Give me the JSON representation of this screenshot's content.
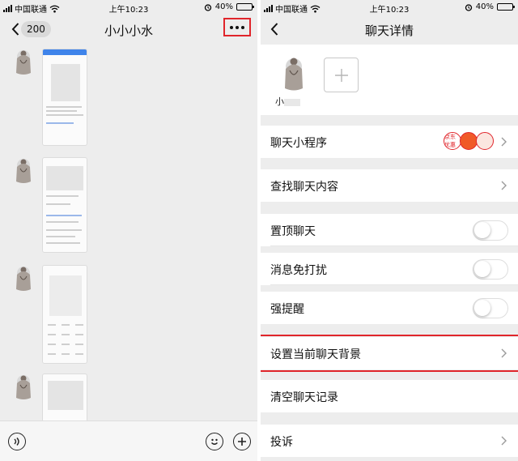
{
  "status_bar": {
    "carrier": "中国联通",
    "time": "上午10:23",
    "battery": "40%",
    "battery_level": 0.4
  },
  "left_screen": {
    "title": "小小小水",
    "unread_count": "200",
    "back_icon": "chevron-left-icon",
    "more_icon": "ellipsis-icon",
    "messages_count_visible": 4,
    "input": {
      "voice_icon": "voice-icon",
      "emoji_icon": "emoji-icon",
      "add_icon": "plus-circle-icon"
    }
  },
  "right_screen": {
    "title": "聊天详情",
    "member": {
      "name": "小"
    },
    "add_member_icon": "plus-icon",
    "rows": {
      "mini_programs": "聊天小程序",
      "mini_program_badges": [
        "京东优惠",
        "",
        ""
      ],
      "search": "查找聊天内容",
      "pin": "置顶聊天",
      "mute": "消息免打扰",
      "reminder": "强提醒",
      "background": "设置当前聊天背景",
      "clear": "清空聊天记录",
      "report": "投诉"
    }
  },
  "colors": {
    "highlight": "#e0252b",
    "background": "#ededed",
    "cell": "#ffffff"
  }
}
